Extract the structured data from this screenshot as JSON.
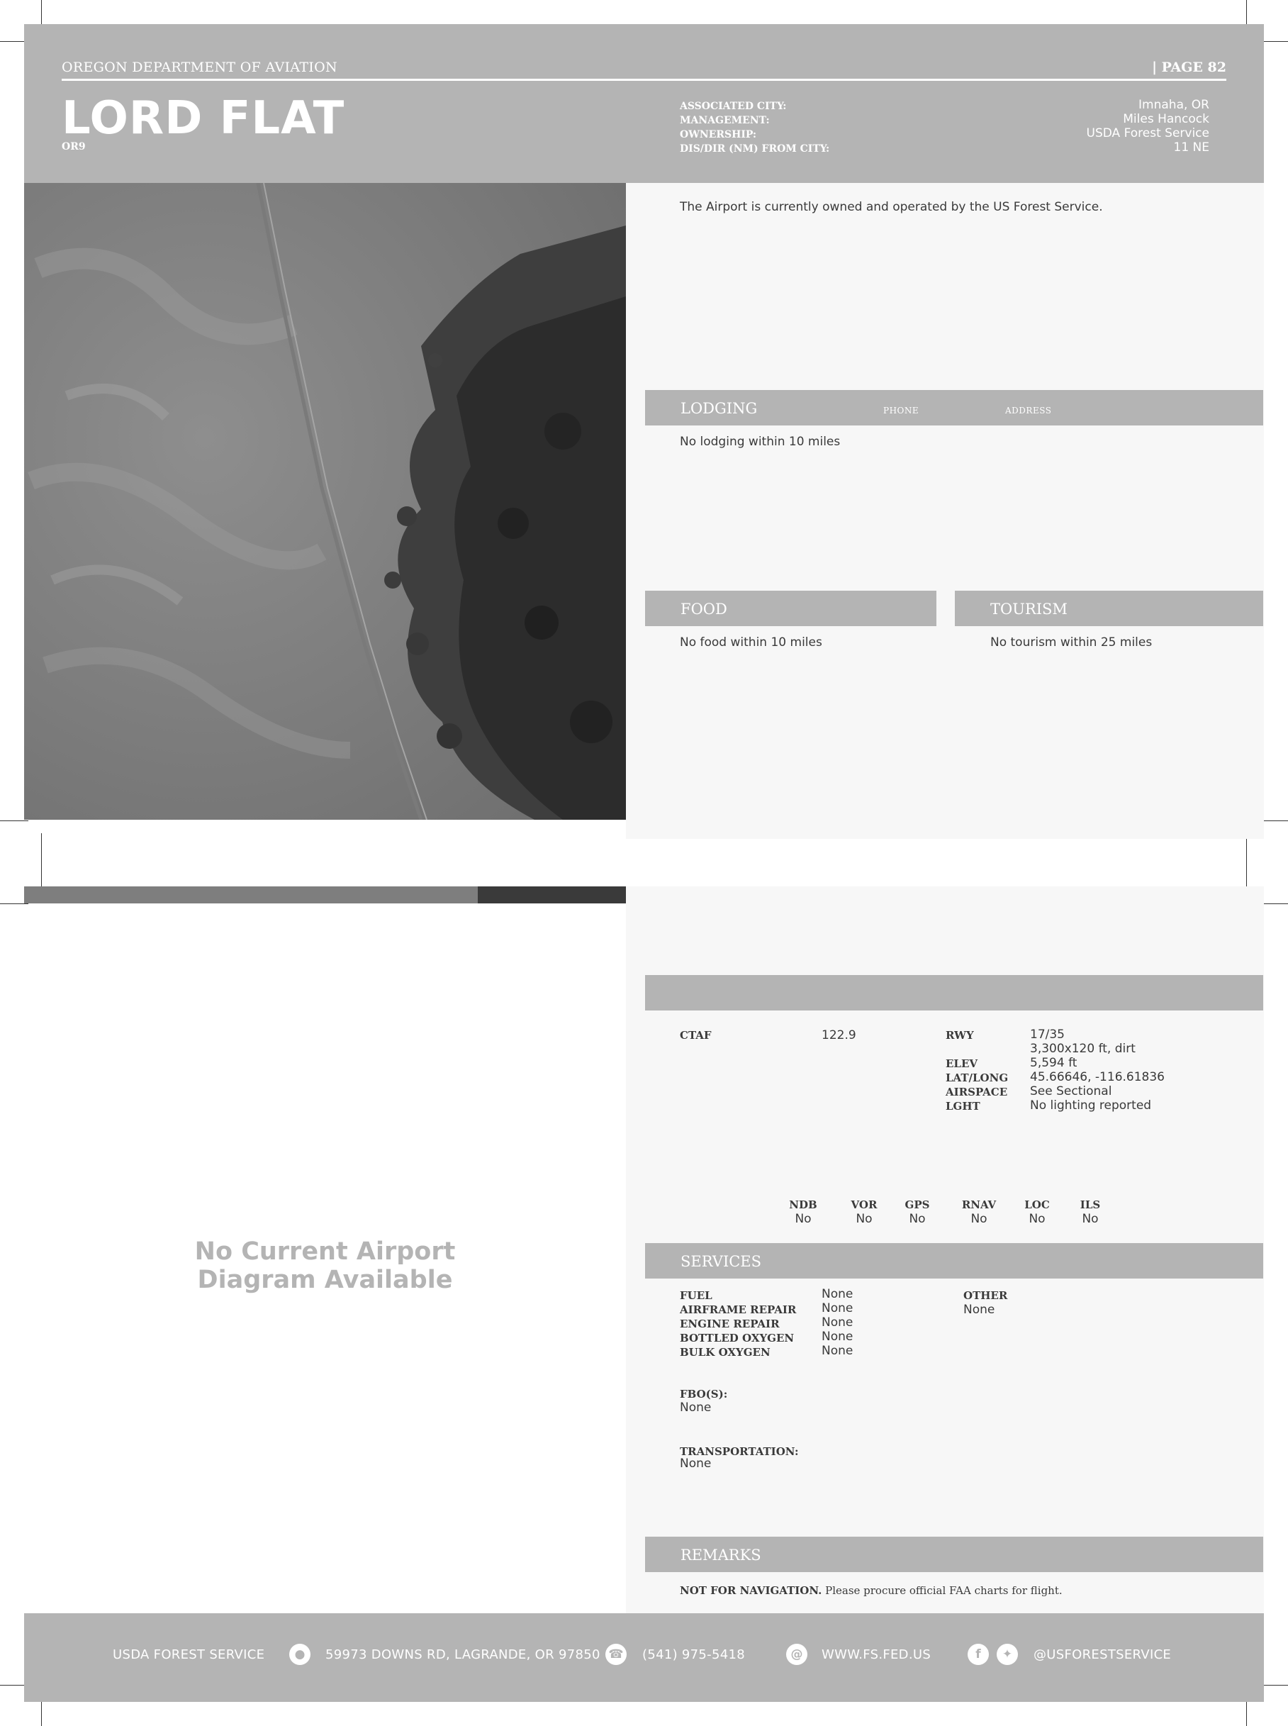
{
  "header": {
    "org": "OREGON DEPARTMENT OF AVIATION",
    "page": "| PAGE 82",
    "title": "LORD FLAT",
    "code": "OR9",
    "labels": [
      "ASSOCIATED CITY:",
      "MANAGEMENT:",
      "OWNERSHIP:",
      "DIS/DIR (NM) FROM CITY:"
    ],
    "values": [
      "Imnaha, OR",
      "Miles Hancock",
      "USDA Forest Service",
      "11 NE"
    ]
  },
  "description": "The Airport is currently owned and operated by the US Forest Service.",
  "lodging": {
    "title": "LODGING",
    "phone_label": "PHONE",
    "address_label": "ADDRESS",
    "text": "No lodging within 10 miles"
  },
  "food": {
    "title": "FOOD",
    "text": "No food within 10 miles"
  },
  "tourism": {
    "title": "TOURISM",
    "text": "No tourism within 25 miles"
  },
  "diagram_placeholder": [
    "No Current Airport",
    "Diagram Available"
  ],
  "airport_info": {
    "ctaf_label": "CTAF",
    "ctaf_value": "122.9",
    "labels": [
      "RWY",
      "",
      "ELEV",
      "LAT/LONG",
      "AIRSPACE",
      "LGHT"
    ],
    "values": [
      "17/35",
      "3,300x120 ft, dirt",
      "5,594 ft",
      "45.66646, -116.61836",
      "See Sectional",
      "No lighting reported"
    ]
  },
  "navaids": [
    {
      "name": "NDB",
      "value": "No"
    },
    {
      "name": "VOR",
      "value": "No"
    },
    {
      "name": "GPS",
      "value": "No"
    },
    {
      "name": "RNAV",
      "value": "No"
    },
    {
      "name": "LOC",
      "value": "No"
    },
    {
      "name": "ILS",
      "value": "No"
    }
  ],
  "services": {
    "title": "SERVICES",
    "labels": [
      "FUEL",
      "AIRFRAME REPAIR",
      "ENGINE REPAIR",
      "BOTTLED OXYGEN",
      "BULK OXYGEN"
    ],
    "values": [
      "None",
      "None",
      "None",
      "None",
      "None"
    ],
    "other_label": "OTHER",
    "other_value": "None",
    "fbo_label": "FBO(S):",
    "fbo_value": "None",
    "transport_label": "TRANSPORTATION:",
    "transport_value": "None"
  },
  "remarks": {
    "title": "REMARKS",
    "bold": "NOT FOR NAVIGATION.",
    "text": "Please procure official FAA charts for flight."
  },
  "footer": {
    "org": "USDA FOREST SERVICE",
    "address": "59973 DOWNS RD, LAGRANDE, OR 97850",
    "phone": "(541) 975-5418",
    "website": "WWW.FS.FED.US",
    "social": "@USFORESTSERVICE",
    "icons": [
      "location-pin-icon",
      "phone-icon",
      "globe-icon",
      "facebook-icon",
      "twitter-icon"
    ]
  },
  "colors": {
    "band": "#b4b4b4",
    "panel": "#f7f7f7",
    "text": "#3a3a3a"
  }
}
